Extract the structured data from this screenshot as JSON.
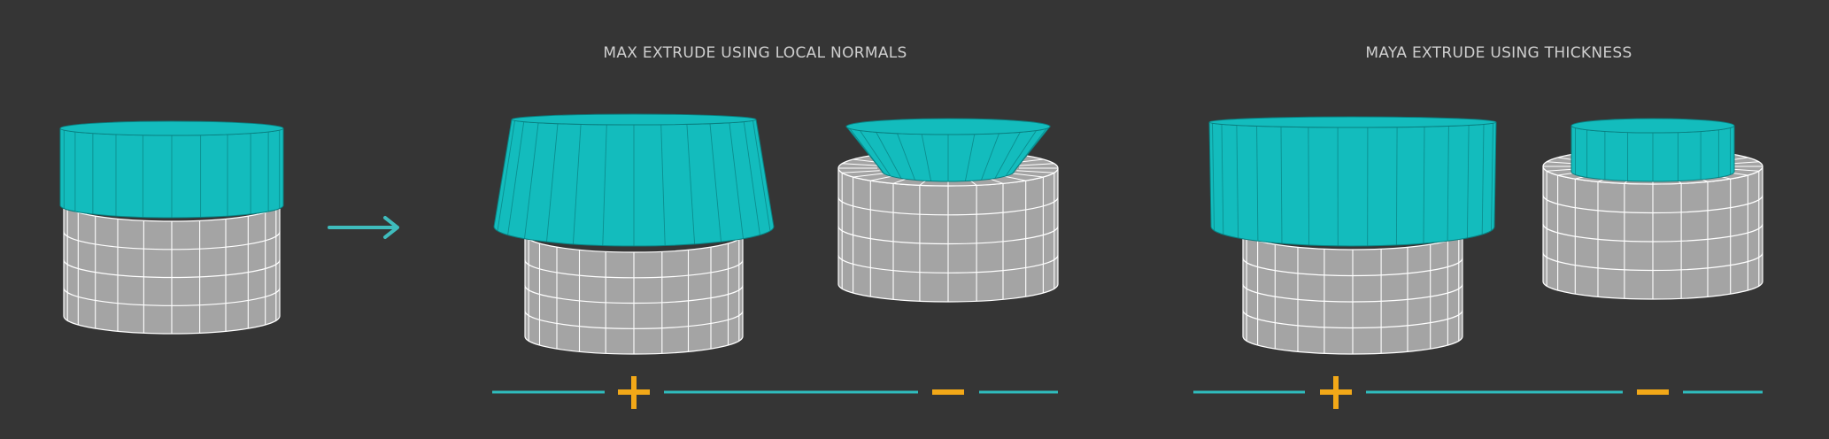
{
  "titles": {
    "max": "MAX EXTRUDE USING LOCAL NORMALS",
    "maya": "MAYA EXTRUDE USING THICKNESS"
  },
  "colors": {
    "background": "#353535",
    "cap": "#13bcbd",
    "cap_line": "#0a7f80",
    "body": "#a4a4a4",
    "body_line": "#ffffff",
    "arrow": "#3fbcbd",
    "plus": "#f2a818",
    "minus": "#f2a818",
    "rule": "#2fbcbd"
  },
  "symbols": {
    "plus": "+",
    "minus": "−"
  },
  "icons": {
    "arrow": "arrow-right-icon",
    "plus": "plus-icon",
    "minus": "minus-icon"
  }
}
